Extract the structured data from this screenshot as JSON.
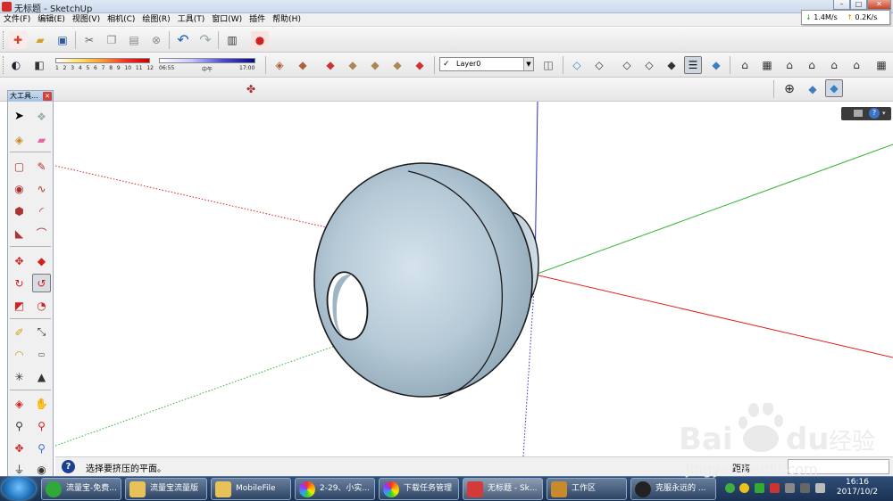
{
  "window": {
    "title": "无标题 - SketchUp"
  },
  "menubar": {
    "items": [
      "文件(F)",
      "编辑(E)",
      "视图(V)",
      "相机(C)",
      "绘图(R)",
      "工具(T)",
      "窗口(W)",
      "插件",
      "帮助(H)"
    ]
  },
  "netspeed": {
    "down": "1.4M/s",
    "up": "0.2K/s"
  },
  "shadow": {
    "month_labels": [
      "1",
      "2",
      "3",
      "4",
      "5",
      "6",
      "7",
      "8",
      "9",
      "10",
      "11",
      "12"
    ],
    "time_start": "06:55",
    "time_mid": "中午",
    "time_end": "17:00"
  },
  "layer": {
    "current": "Layer0"
  },
  "tool_panel": {
    "title": "大工具..."
  },
  "status": {
    "message": "选择要挤压的平面。",
    "distance_label": "距离",
    "distance_value": ""
  },
  "taskbar": {
    "tasks": [
      {
        "label": "流量宝-免费...",
        "color": "#2faa3a"
      },
      {
        "label": "流量宝流量版",
        "color": "#e9c15a"
      },
      {
        "label": "MobileFile",
        "color": "#e9c15a"
      },
      {
        "label": "2-29、小实...",
        "color": "#d94aa8"
      },
      {
        "label": "下载任务管理",
        "color": "#3b8fe0"
      },
      {
        "label": "无标题 - Sk...",
        "color": "#d33a3a"
      },
      {
        "label": "工作区",
        "color": "#c98a2c"
      },
      {
        "label": "克服永远的 ...",
        "color": "#222222"
      }
    ],
    "clock_time": "16:16",
    "clock_date": "2017/10/2"
  },
  "watermark": {
    "brand": "Bai",
    "brand2": "du",
    "suffix": "经验",
    "url": "jingyan.baidu.com"
  },
  "colors": {
    "axis_red": "#e02020",
    "axis_green": "#2fb52f",
    "axis_blue": "#2a2ad8",
    "model_fill": "#b9cbd8",
    "accent": "#1d3f8f"
  }
}
